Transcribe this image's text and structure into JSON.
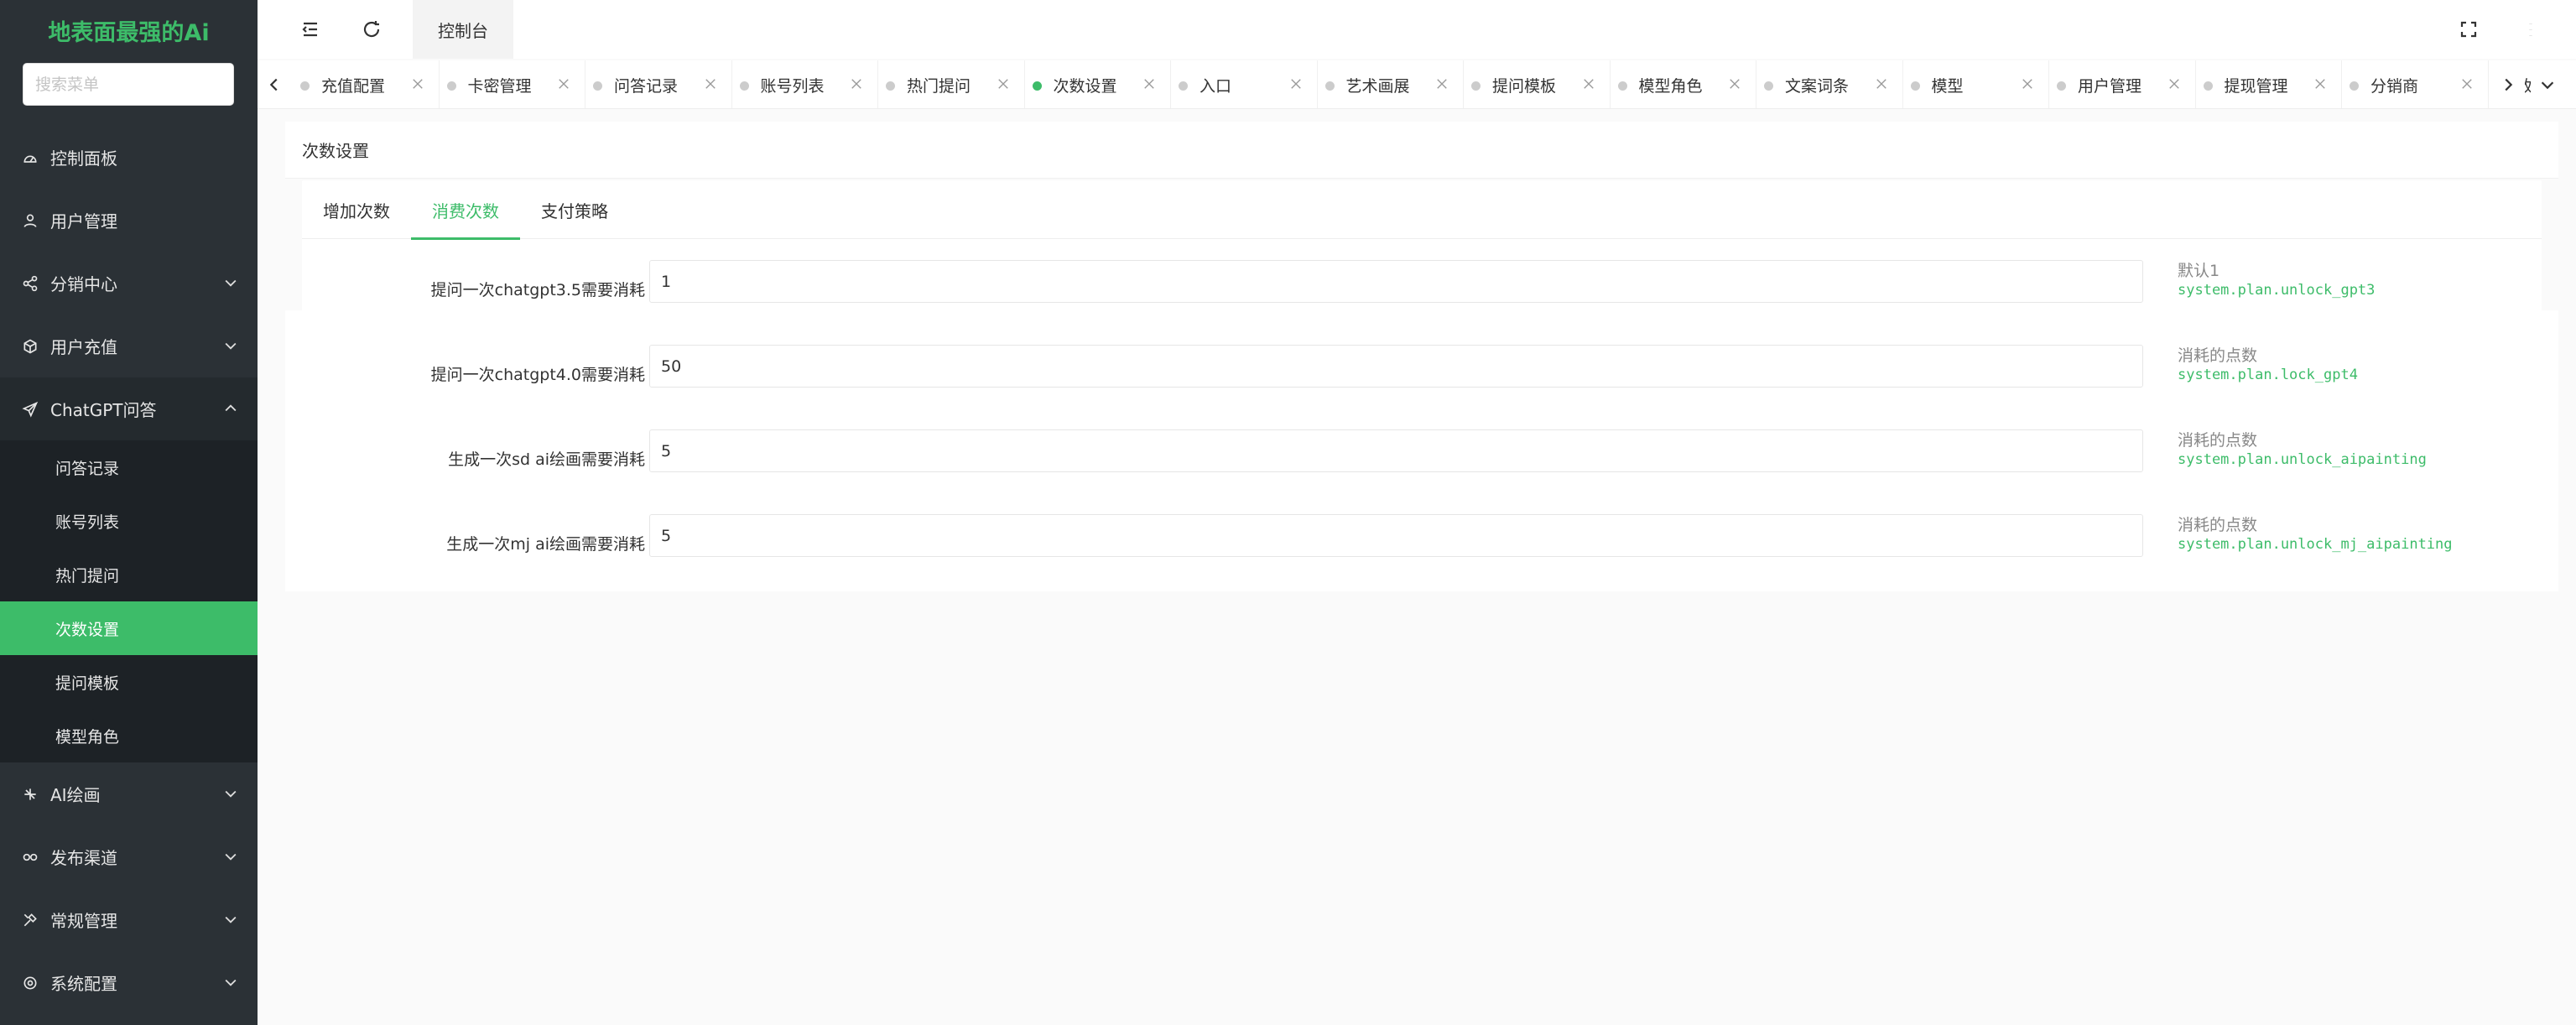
{
  "sidebar": {
    "logo": "地表面最强的Ai",
    "search_placeholder": "搜索菜单",
    "menu": [
      {
        "label": "控制面板",
        "icon": "dashboard-icon"
      },
      {
        "label": "用户管理",
        "icon": "user-icon"
      },
      {
        "label": "分销中心",
        "icon": "share-icon"
      },
      {
        "label": "用户充值",
        "icon": "box-icon"
      },
      {
        "label": "ChatGPT问答",
        "icon": "send-icon"
      },
      {
        "label": "AI绘画",
        "icon": "ai-icon"
      },
      {
        "label": "发布渠道",
        "icon": "link-icon"
      },
      {
        "label": "常规管理",
        "icon": "tools-icon"
      },
      {
        "label": "系统配置",
        "icon": "settings-icon"
      }
    ],
    "submenu": [
      "问答记录",
      "账号列表",
      "热门提问",
      "次数设置",
      "提问模板",
      "模型角色"
    ],
    "active_sub": "次数设置"
  },
  "topbar": {
    "home_tab": "控制台"
  },
  "tabs": [
    "充值配置",
    "卡密管理",
    "问答记录",
    "账号列表",
    "热门提问",
    "次数设置",
    "入口",
    "艺术画展",
    "提问模板",
    "模型角色",
    "文案词条",
    "模型",
    "用户管理",
    "提现管理",
    "分销商",
    "收入记"
  ],
  "active_tab": "次数设置",
  "page": {
    "title": "次数设置",
    "inner_tabs": [
      "增加次数",
      "消费次数",
      "支付策略"
    ],
    "active_inner_tab": "消费次数",
    "fields": [
      {
        "label": "提问一次chatgpt3.5需要消耗",
        "value": "1",
        "help": "默认1",
        "key": "system.plan.unlock_gpt3"
      },
      {
        "label": "提问一次chatgpt4.0需要消耗",
        "value": "50",
        "help": "消耗的点数",
        "key": "system.plan.lock_gpt4"
      },
      {
        "label": "生成一次sd ai绘画需要消耗",
        "value": "5",
        "help": "消耗的点数",
        "key": "system.plan.unlock_aipainting"
      },
      {
        "label": "生成一次mj ai绘画需要消耗",
        "value": "5",
        "help": "消耗的点数",
        "key": "system.plan.unlock_mj_aipainting"
      }
    ]
  },
  "colors": {
    "accent": "#3dbc69",
    "sidebar": "#2b3136",
    "submenu": "#1d2226"
  }
}
